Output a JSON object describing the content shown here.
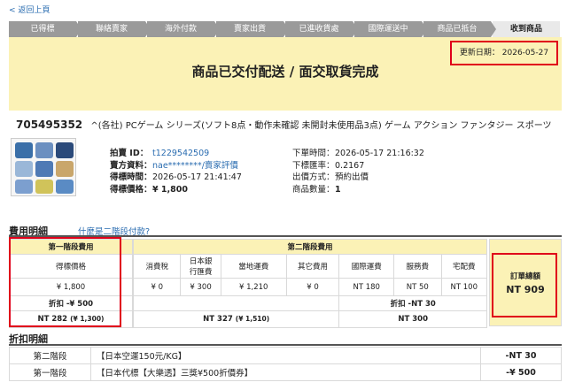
{
  "nav": {
    "back_label": "< 返回上頁"
  },
  "steps": [
    {
      "label": "已得標",
      "active": false
    },
    {
      "label": "聯絡賣家",
      "active": false
    },
    {
      "label": "海外付款",
      "active": false
    },
    {
      "label": "賣家出貨",
      "active": false
    },
    {
      "label": "已進收貨處",
      "active": false
    },
    {
      "label": "國際運送中",
      "active": false
    },
    {
      "label": "商品已抵台",
      "active": false
    },
    {
      "label": "收到商品",
      "active": true
    }
  ],
  "status": {
    "title": "商品已交付配送 / 面交取貨完成",
    "update_label": "更新日期：",
    "update_date": "2026-05-27"
  },
  "item": {
    "id": "705495352",
    "title": "^(各社) PCゲーム シリーズ(ソフト8点・動作未確認 未開封未使用品3点) ゲーム アクション ファンタジー スポーツ",
    "left": {
      "auction_id_label": "拍賣 ID：",
      "auction_id": "t1229542509",
      "seller_label": "賣方資料：",
      "seller": "nae********",
      "seller_rating": "/賣家評價",
      "won_time_label": "得標時間：",
      "won_time": "2026-05-17 21:41:47",
      "won_price_label": "得標價格：",
      "won_price": "¥ 1,800"
    },
    "right": {
      "order_time_label": "下單時間：",
      "order_time": "2026-05-17 21:16:32",
      "rate_label": "下標匯率：",
      "rate": "0.2167",
      "ship_status_label": "出價方式：",
      "ship_status": "預約出價",
      "qty_label": "商品數量：",
      "qty": "1"
    }
  },
  "fees": {
    "section_title": "費用明細",
    "help_link": "什麼是二階段付款?",
    "stage1": {
      "header": "第一階段費用",
      "col": "得標價格",
      "value": "¥ 1,800",
      "discount": "折扣 -¥ 500",
      "total": "NT 282",
      "total_sub": "(¥ 1,300)"
    },
    "stage2": {
      "header": "第二階段費用",
      "cols": [
        "消費稅",
        "日本銀行匯費",
        "當地運費",
        "其它費用",
        "國際運費",
        "服務費",
        "宅配費"
      ],
      "values": [
        "¥ 0",
        "¥ 300",
        "¥ 1,210",
        "¥ 0",
        "NT 180",
        "NT 50",
        "NT 100"
      ],
      "discount": "折扣 -NT 30",
      "yen_total": "NT 327",
      "yen_total_sub": "(¥ 1,510)",
      "nt_total": "NT 300"
    },
    "order_total": {
      "label": "訂單總額",
      "value": "NT 909"
    }
  },
  "discounts": {
    "section_title": "折扣明細",
    "rows": [
      {
        "stage": "第二階段",
        "desc": "【日本空運150元/KG】",
        "amount": "-NT 30"
      },
      {
        "stage": "第一階段",
        "desc": "【日本代標【大樂透】三獎¥500折價券】",
        "amount": "-¥ 500"
      }
    ]
  },
  "colors": {
    "highlight": "#e0001a",
    "banner": "#fbf2b6",
    "link": "#2a6cb0",
    "step": "#9a9a9a"
  }
}
